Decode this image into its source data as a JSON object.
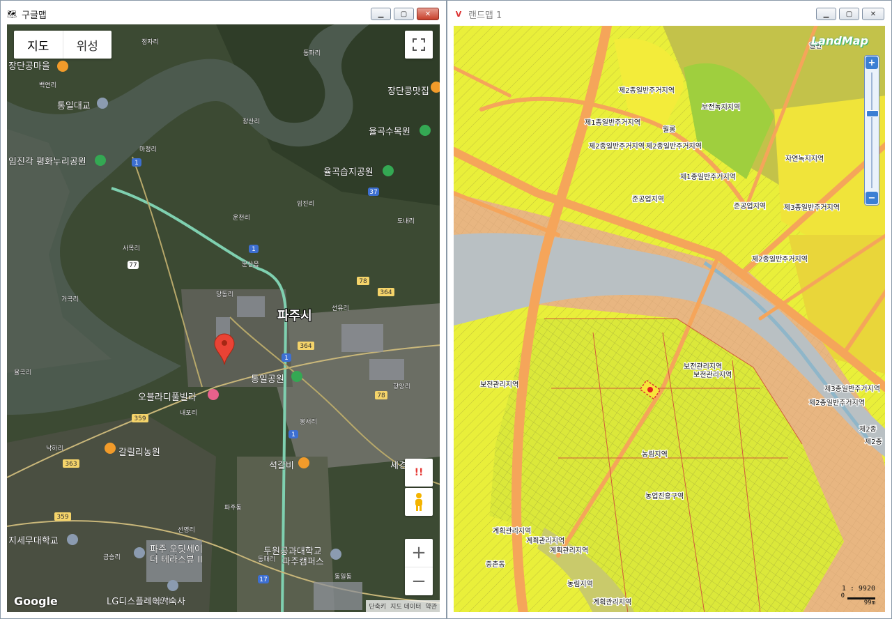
{
  "left_window": {
    "title": "구글맵",
    "map_type": {
      "map": "지도",
      "satellite": "위성"
    },
    "labels": [
      {
        "text": "장단공마을",
        "size": 13
      },
      {
        "text": "통일대교",
        "size": 13
      },
      {
        "text": "장단콩맛집",
        "size": 13
      },
      {
        "text": "율곡수목원",
        "size": 13
      },
      {
        "text": "임진각 평화누리공원",
        "size": 13
      },
      {
        "text": "율곡습지공원",
        "size": 13
      },
      {
        "text": "파주시",
        "size": 18
      },
      {
        "text": "통일공원",
        "size": 13
      },
      {
        "text": "오블라디풀빌라",
        "size": 13
      },
      {
        "text": "갈릴리농원",
        "size": 13
      },
      {
        "text": "석갈비",
        "size": 13
      },
      {
        "text": "세경",
        "size": 13
      },
      {
        "text": "지세무대학교",
        "size": 13
      },
      {
        "text": "파주 오딧세이",
        "size": 13
      },
      {
        "text": "더 테라스뷰 II",
        "size": 13
      },
      {
        "text": "두원공과대학교",
        "size": 13
      },
      {
        "text": "파주캠퍼스",
        "size": 13
      },
      {
        "text": "LG디스플레이기숙사",
        "size": 13
      },
      {
        "text": "정자리",
        "size": 9
      },
      {
        "text": "동파리",
        "size": 9
      },
      {
        "text": "백연리",
        "size": 9
      },
      {
        "text": "장산리",
        "size": 9
      },
      {
        "text": "마정리",
        "size": 9
      },
      {
        "text": "임진리",
        "size": 9
      },
      {
        "text": "운천리",
        "size": 9
      },
      {
        "text": "사목리",
        "size": 9
      },
      {
        "text": "문산읍",
        "size": 9
      },
      {
        "text": "당동리",
        "size": 9
      },
      {
        "text": "선유리",
        "size": 9
      },
      {
        "text": "거곡리",
        "size": 9
      },
      {
        "text": "내포리",
        "size": 9
      },
      {
        "text": "향양리",
        "size": 9
      },
      {
        "text": "봉서리",
        "size": 9
      },
      {
        "text": "낙하리",
        "size": 9
      },
      {
        "text": "금승리",
        "size": 9
      },
      {
        "text": "선영리",
        "size": 9
      },
      {
        "text": "동패리",
        "size": 9
      },
      {
        "text": "동일동",
        "size": 9
      },
      {
        "text": "파주동",
        "size": 9
      },
      {
        "text": "능산리",
        "size": 9
      },
      {
        "text": "도내리",
        "size": 9
      },
      {
        "text": "율곡리",
        "size": 9
      }
    ],
    "routes": [
      "1",
      "77",
      "1",
      "78",
      "364",
      "364",
      "1",
      "78",
      "359",
      "363",
      "359",
      "1",
      "17",
      "37"
    ],
    "buttons": {
      "fullscreen": "fullscreen",
      "alert": "!!",
      "zoom_in": "+",
      "zoom_out": "−"
    },
    "logo": "Google",
    "attribution": [
      "단축키",
      "지도 데이터",
      "약관"
    ]
  },
  "right_window": {
    "title": "랜드맵 1",
    "logo": "LandMap",
    "zones": [
      "제2종일반주거지역",
      "보전녹지지역",
      "제1종일반주거지역",
      "제2종일반주거지역",
      "제2종일반주거지역",
      "제1종일반주거지역",
      "자연녹지지역",
      "준공업지역",
      "준공업지역",
      "제3종일반주거지역",
      "제2종일반주거지역",
      "보전관리지역",
      "보전관리지역",
      "보전관리지역",
      "제3종일반주거지역",
      "제2종일반주거지역",
      "농림지역",
      "농업진흥구역",
      "계획관리지역",
      "계획관리지역",
      "계획관리지역",
      "농림지역",
      "계획관리지역",
      "중촌동",
      "월롱",
      "일반",
      "제2종",
      "제2종"
    ],
    "zoom": {
      "in": "+",
      "out": "−"
    },
    "scale": {
      "ratio": "1 : 9920",
      "bar": "99m"
    }
  },
  "colors": {
    "water": "#4c5a4e",
    "road": "#f5a55a",
    "residential": "#f4e83c",
    "green": "#b8d84a",
    "farmland": "#d7ea3c",
    "river": "#b9c0c3",
    "mgmt": "#e6b17e"
  }
}
